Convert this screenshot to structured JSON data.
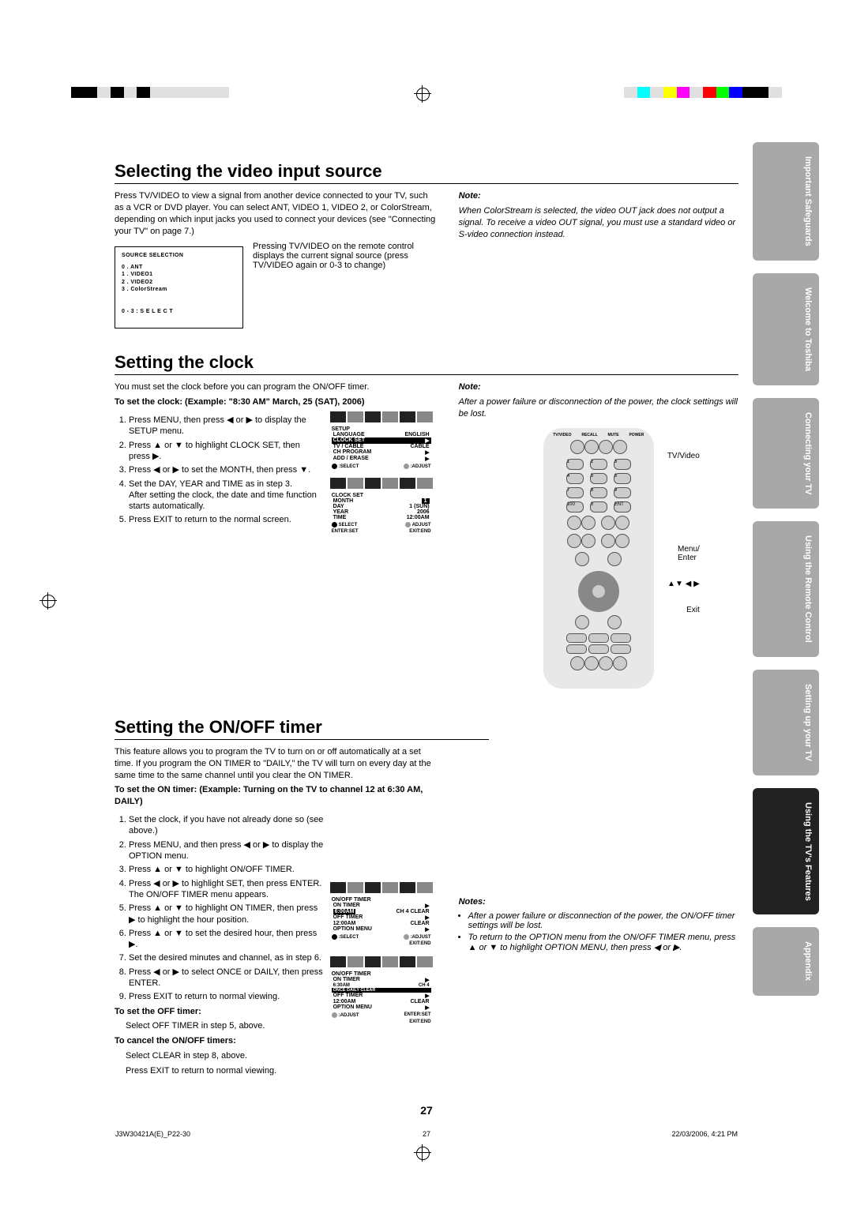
{
  "header": {
    "section1": "Selecting the video input source",
    "section2": "Setting the clock",
    "section3": "Setting the ON/OFF timer"
  },
  "videoSource": {
    "para": "Press TV/VIDEO to view a signal from another device connected to your TV, such as a VCR or DVD player. You can select ANT, VIDEO 1, VIDEO 2, or ColorStream, depending on which input jacks you used to connect your devices (see \"Connecting your TV\" on page 7.)",
    "menuTitle": "SOURCE SELECTION",
    "opt0": "0 . ANT",
    "opt1": "1 . VIDEO1",
    "opt2": "2 . VIDEO2",
    "opt3": "3 . ColorStream",
    "menuFoot": "0 - 3 : S E L E C T",
    "caption": "Pressing TV/VIDEO on the remote control displays the current signal source (press TV/VIDEO again or 0-3 to change)",
    "noteLabel": "Note:",
    "noteBody": "When ColorStream is selected, the video OUT jack does not output a signal. To receive a video OUT signal, you must use a standard video or S-video connection instead."
  },
  "clock": {
    "intro": "You must set the clock before you can program the ON/OFF timer.",
    "exampleLabel": "To set the clock: (Example: \"8:30 AM\" March, 25 (SAT), 2006)",
    "steps": {
      "s1": "Press MENU, then press ◀ or ▶ to display the SETUP menu.",
      "s2": "Press ▲ or ▼ to highlight CLOCK SET, then press ▶.",
      "s3": "Press ◀ or ▶ to set the MONTH, then press ▼.",
      "s4": "Set the DAY, YEAR and TIME as in step 3.",
      "s4b": "After setting the clock, the date and time function starts automatically.",
      "s5": "Press EXIT to return to the normal screen."
    },
    "noteLabel": "Note:",
    "noteBody": "After a power failure or disconnection of the power, the clock settings will be lost.",
    "osd1": {
      "title": "SETUP",
      "r1a": "LANGUAGE",
      "r1b": "ENGLISH",
      "r2a": "CLOCK SET",
      "r2b": "▶",
      "r3a": "TV / CABLE",
      "r3b": "CABLE",
      "r4a": "CH PROGRAM",
      "r4b": "▶",
      "r5a": "ADD / ERASE",
      "r5b": "▶",
      "f1": ":SELECT",
      "f2": ":ADJUST"
    },
    "osd2": {
      "title": "CLOCK SET",
      "r1a": "MONTH",
      "r1b": "1",
      "r2a": "DAY",
      "r2b": "1 (SUN)",
      "r3a": "YEAR",
      "r3b": "2006",
      "r4a": "TIME",
      "r4b": "12:00AM",
      "f1": "SELECT",
      "f2": "ADJUST",
      "f3": "ENTER:SET",
      "f4": "EXIT:END"
    }
  },
  "onoff": {
    "intro": "This feature allows you to program the TV to turn on or off automatically at a set time. If you program the ON TIMER to \"DAILY,\" the TV will turn on every day at the same time to the same channel until you clear the ON TIMER.",
    "exampleLabel": "To set the ON timer: (Example: Turning on the TV to channel 12 at 6:30 AM, DAILY)",
    "steps": {
      "s1": "Set the clock, if you have not already done so (see above.)",
      "s2": "Press MENU, and then press ◀ or ▶ to display the OPTION menu.",
      "s3": "Press ▲ or ▼ to highlight ON/OFF TIMER.",
      "s4": "Press ◀ or ▶ to highlight SET, then press ENTER. The ON/OFF TIMER menu appears.",
      "s5": "Press ▲ or ▼ to highlight ON TIMER, then press ▶ to highlight the hour position.",
      "s6": "Press ▲ or ▼ to set the desired hour, then press ▶.",
      "s7": "Set the desired minutes and channel, as in step 6.",
      "s8": "Press ◀ or ▶ to select ONCE or DAILY, then press ENTER.",
      "s9": "Press EXIT to return to normal viewing."
    },
    "offLabel": "To set the OFF timer:",
    "offBody": "Select OFF TIMER in step 5, above.",
    "cancelLabel": "To cancel the ON/OFF timers:",
    "cancelBody1": "Select CLEAR in step 8, above.",
    "cancelBody2": "Press EXIT to return to normal viewing.",
    "notesLabel": "Notes:",
    "note1": "After a power failure or disconnection of the power, the ON/OFF timer settings will be lost.",
    "note2": "To return to the OPTION menu from the ON/OFF TIMER menu, press ▲ or ▼ to highlight OPTION MENU, then press ◀ or ▶.",
    "osd3": {
      "title": "ON/OFF TIMER",
      "r1a": "ON TIMER",
      "r1b": "▶",
      "r1c": "6:00AM",
      "r1d": "CH  4",
      "r1e": "CLEAR",
      "r2a": "OFF TIMER",
      "r2b": "▶",
      "r2c": "12:00AM",
      "r2d": "CLEAR",
      "r3a": "OPTION MENU",
      "r3b": "▶",
      "f1": ":SELECT",
      "f2": ":ADJUST",
      "f3": "EXIT:END"
    },
    "osd4": {
      "title": "ON/OFF TIMER",
      "r1a": "ON TIMER",
      "r1b": "▶",
      "r1c": "6:30AM",
      "r1d": "CH  4",
      "r1e": "ONCE DAILY CLEAR",
      "r2a": "OFF TIMER",
      "r2b": "▶",
      "r2c": "12:00AM",
      "r2d": "CLEAR",
      "r3a": "OPTION MENU",
      "r3b": "▶",
      "f1": ":ADJUST",
      "f2": "ENTER:SET",
      "f3": "EXIT:END"
    }
  },
  "remote": {
    "topRow": {
      "a": "TV/VIDEO",
      "b": "RECALL",
      "c": "MUTE",
      "d": "POWER"
    },
    "numRow3": {
      "a": "100",
      "b": "0",
      "c": "ENT"
    },
    "label1": "TV/Video",
    "label2": "Menu/\nEnter",
    "label3": "▲▼ ◀ ▶",
    "label4": "Exit"
  },
  "tabs": {
    "t1": "Important\nSafeguards",
    "t2": "Welcome to\nToshiba",
    "t3": "Connecting\nyour TV",
    "t4": "Using the\nRemote Control",
    "t5": "Setting up\nyour TV",
    "t6": "Using the TV's\nFeatures",
    "t7": "Appendix"
  },
  "pagenum": "27",
  "footer": {
    "left": "J3W30421A(E)_P22-30",
    "mid": "27",
    "right": "22/03/2006, 4:21 PM"
  }
}
